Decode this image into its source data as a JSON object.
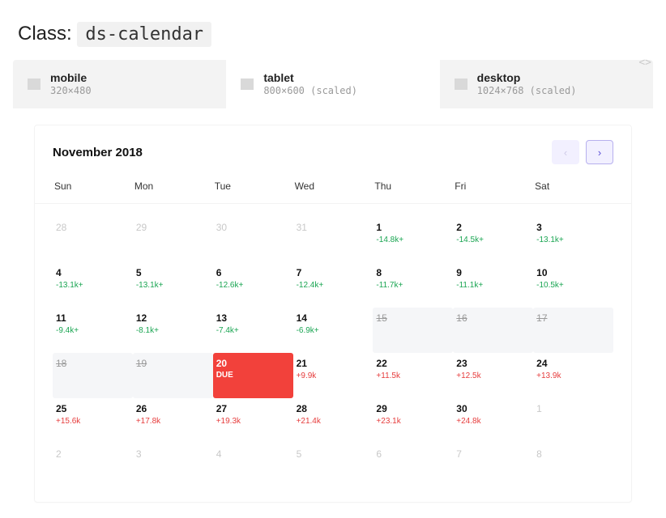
{
  "header": {
    "prefix": "Class: ",
    "class_name": "ds-calendar",
    "code_toggle": "<>"
  },
  "tabs": [
    {
      "id": "mobile",
      "label": "mobile",
      "dims": "320×480"
    },
    {
      "id": "tablet",
      "label": "tablet",
      "dims": "800×600 (scaled)"
    },
    {
      "id": "desktop",
      "label": "desktop",
      "dims": "1024×768 (scaled)"
    }
  ],
  "active_tab": "tablet",
  "calendar": {
    "title": "November 2018",
    "nav": {
      "prev": "‹",
      "next": "›"
    },
    "dow": [
      "Sun",
      "Mon",
      "Tue",
      "Wed",
      "Thu",
      "Fri",
      "Sat"
    ],
    "cells": [
      {
        "n": "28",
        "muted": true
      },
      {
        "n": "29",
        "muted": true
      },
      {
        "n": "30",
        "muted": true
      },
      {
        "n": "31",
        "muted": true
      },
      {
        "n": "1",
        "val": "-14.8k+",
        "vclass": "green"
      },
      {
        "n": "2",
        "val": "-14.5k+",
        "vclass": "green"
      },
      {
        "n": "3",
        "val": "-13.1k+",
        "vclass": "green"
      },
      {
        "n": "4",
        "val": "-13.1k+",
        "vclass": "green"
      },
      {
        "n": "5",
        "val": "-13.1k+",
        "vclass": "green"
      },
      {
        "n": "6",
        "val": "-12.6k+",
        "vclass": "green"
      },
      {
        "n": "7",
        "val": "-12.4k+",
        "vclass": "green"
      },
      {
        "n": "8",
        "val": "-11.7k+",
        "vclass": "green"
      },
      {
        "n": "9",
        "val": "-11.1k+",
        "vclass": "green"
      },
      {
        "n": "10",
        "val": "-10.5k+",
        "vclass": "green"
      },
      {
        "n": "11",
        "val": "-9.4k+",
        "vclass": "green"
      },
      {
        "n": "12",
        "val": "-8.1k+",
        "vclass": "green"
      },
      {
        "n": "13",
        "val": "-7.4k+",
        "vclass": "green"
      },
      {
        "n": "14",
        "val": "-6.9k+",
        "vclass": "green"
      },
      {
        "n": "15",
        "strike": true
      },
      {
        "n": "16",
        "strike": true
      },
      {
        "n": "17",
        "strike": true
      },
      {
        "n": "18",
        "strike": true
      },
      {
        "n": "19",
        "strike": true
      },
      {
        "n": "20",
        "due": true,
        "due_label": "DUE"
      },
      {
        "n": "21",
        "val": "+9.9k",
        "vclass": "red"
      },
      {
        "n": "22",
        "val": "+11.5k",
        "vclass": "red"
      },
      {
        "n": "23",
        "val": "+12.5k",
        "vclass": "red"
      },
      {
        "n": "24",
        "val": "+13.9k",
        "vclass": "red"
      },
      {
        "n": "25",
        "val": "+15.6k",
        "vclass": "red"
      },
      {
        "n": "26",
        "val": "+17.8k",
        "vclass": "red"
      },
      {
        "n": "27",
        "val": "+19.3k",
        "vclass": "red"
      },
      {
        "n": "28",
        "val": "+21.4k",
        "vclass": "red"
      },
      {
        "n": "29",
        "val": "+23.1k",
        "vclass": "red"
      },
      {
        "n": "30",
        "val": "+24.8k",
        "vclass": "red"
      },
      {
        "n": "1",
        "muted": true
      },
      {
        "n": "2",
        "muted": true
      },
      {
        "n": "3",
        "muted": true
      },
      {
        "n": "4",
        "muted": true
      },
      {
        "n": "5",
        "muted": true
      },
      {
        "n": "6",
        "muted": true
      },
      {
        "n": "7",
        "muted": true
      },
      {
        "n": "8",
        "muted": true
      }
    ]
  }
}
